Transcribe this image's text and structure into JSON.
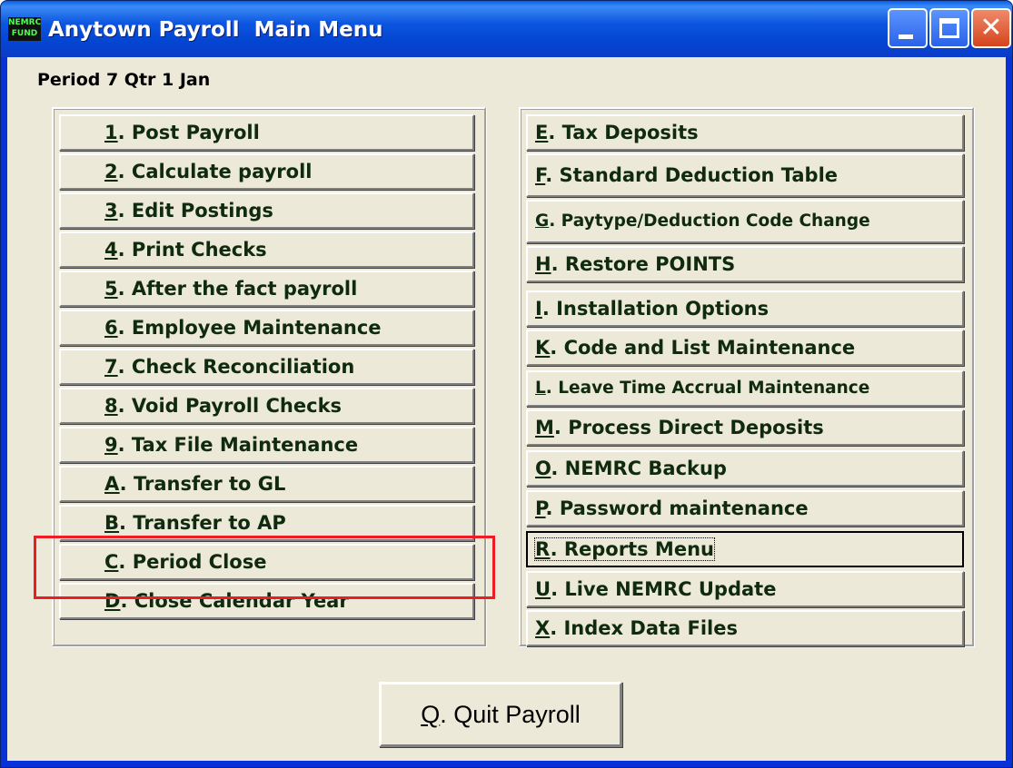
{
  "window": {
    "icon_text": "NEMRC FUND",
    "title": "Anytown Payroll  Main Menu"
  },
  "period_label": "Period 7 Qtr 1 Jan",
  "left_menu": [
    {
      "key": "1",
      "label": ". Post Payroll"
    },
    {
      "key": "2",
      "label": ". Calculate payroll"
    },
    {
      "key": "3",
      "label": ". Edit Postings"
    },
    {
      "key": "4",
      "label": ". Print Checks"
    },
    {
      "key": "5",
      "label": ". After the fact payroll"
    },
    {
      "key": "6",
      "label": ". Employee Maintenance"
    },
    {
      "key": "7",
      "label": ". Check Reconciliation"
    },
    {
      "key": "8",
      "label": ". Void Payroll Checks"
    },
    {
      "key": "9",
      "label": ". Tax File Maintenance"
    },
    {
      "key": "A",
      "label": ". Transfer to GL"
    },
    {
      "key": "B",
      "label": ". Transfer to AP"
    },
    {
      "key": "C",
      "label": ". Period Close"
    },
    {
      "key": "D",
      "label": ". Close Calendar Year"
    }
  ],
  "right_menu": [
    {
      "key": "E",
      "label": ". Tax Deposits"
    },
    {
      "key": "F",
      "label": ". Standard Deduction Table"
    },
    {
      "key": "G",
      "label": ". Paytype/Deduction Code Change"
    },
    {
      "key": "H",
      "label": ".  Restore POINTS"
    },
    {
      "key": "I",
      "label": ".  Installation Options"
    },
    {
      "key": "K",
      "label": ". Code and List Maintenance"
    },
    {
      "key": "L",
      "label": ". Leave Time Accrual Maintenance"
    },
    {
      "key": "M",
      "label": ". Process Direct Deposits"
    },
    {
      "key": "O",
      "label": ". NEMRC Backup"
    },
    {
      "key": "P",
      "label": ".  Password maintenance"
    },
    {
      "key": "R",
      "label": ".  Reports Menu"
    },
    {
      "key": "U",
      "label": ". Live NEMRC Update"
    },
    {
      "key": "X",
      "label": ".  Index Data Files"
    }
  ],
  "quit_button": {
    "key": "Q",
    "label": ". Quit Payroll"
  },
  "colors": {
    "highlight_box": "#ee1c25",
    "menu_text": "#0f2a0f",
    "titlebar": "#0346d2"
  }
}
